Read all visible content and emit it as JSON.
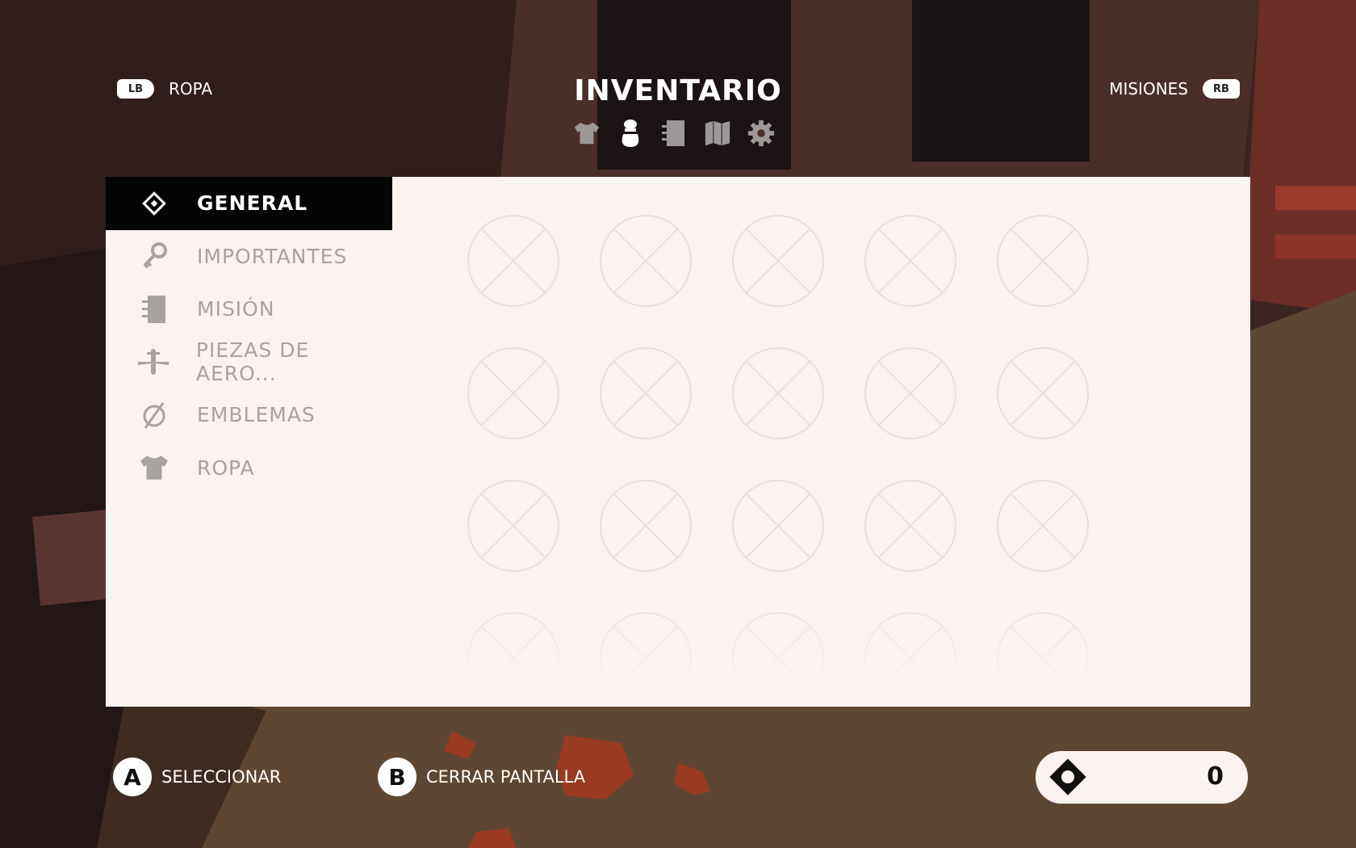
{
  "header": {
    "title": "INVENTARIO",
    "left": {
      "button": "LB",
      "label": "ROPA"
    },
    "right": {
      "button": "RB",
      "label": "MISIONES"
    },
    "tabs": [
      {
        "icon": "shirt-icon",
        "active": false
      },
      {
        "icon": "bag-icon",
        "active": true
      },
      {
        "icon": "journal-icon",
        "active": false
      },
      {
        "icon": "map-icon",
        "active": false
      },
      {
        "icon": "gear-icon",
        "active": false
      }
    ]
  },
  "categories": [
    {
      "label": "GENERAL",
      "icon": "diamond-icon",
      "active": true
    },
    {
      "label": "IMPORTANTES",
      "icon": "key-icon",
      "active": false
    },
    {
      "label": "MISIÓN",
      "icon": "journal-icon",
      "active": false
    },
    {
      "label": "PIEZAS DE AERO...",
      "icon": "airplane-icon",
      "active": false
    },
    {
      "label": "EMBLEMAS",
      "icon": "emblem-icon",
      "active": false
    },
    {
      "label": "ROPA",
      "icon": "shirt-icon",
      "active": false
    }
  ],
  "grid": {
    "columns": 5,
    "rows": 4,
    "state": "empty"
  },
  "footer": {
    "select": {
      "button": "A",
      "label": "SELECCIONAR"
    },
    "close": {
      "button": "B",
      "label": "CERRAR PANTALLA"
    },
    "currency": {
      "icon": "currency-diamond-icon",
      "value": "0"
    }
  },
  "colors": {
    "panel": "#fbf3f0",
    "active_category_bg": "#050505",
    "inactive_text": "#a8a2a0",
    "empty_slot": "#e9e0dd"
  }
}
